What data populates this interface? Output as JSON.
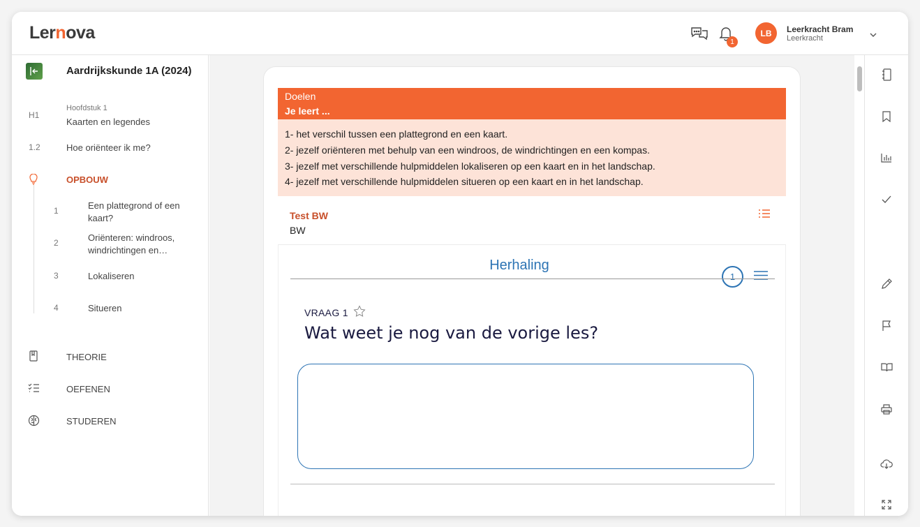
{
  "header": {
    "logo_left": "Ler",
    "logo_n": "n",
    "logo_right": "ova",
    "notification_count": "1",
    "user_initials": "LB",
    "user_name": "Leerkracht Bram",
    "user_role": "Leerkracht"
  },
  "sidebar": {
    "course_title": "Aardrijkskunde 1A (2024)",
    "chapter_code": "H1",
    "chapter_label": "Hoofdstuk 1",
    "chapter_title": "Kaarten en legendes",
    "section_code": "1.2",
    "section_title": "Hoe oriënteer ik me?",
    "opbouw_label": "OPBOUW",
    "opbouw_items": [
      {
        "num": "1",
        "line1": "Een plattegrond of een",
        "line2": "kaart?"
      },
      {
        "num": "2",
        "line1": "Oriënteren: windroos,",
        "line2": "windrichtingen en…"
      },
      {
        "num": "3",
        "line1": "Lokaliseren",
        "line2": ""
      },
      {
        "num": "4",
        "line1": "Situeren",
        "line2": ""
      }
    ],
    "theorie_label": "THEORIE",
    "oefenen_label": "OEFENEN",
    "studeren_label": "STUDEREN"
  },
  "doelen": {
    "title": "Doelen",
    "subtitle": "Je leert ...",
    "goals": [
      "1- het verschil tussen een plattegrond en een kaart.",
      "2- jezelf oriënteren met behulp van een windroos, de windrichtingen en een kompas.",
      "3- jezelf met verschillende hulpmiddelen lokaliseren op een kaart en in het landschap.",
      "4- jezelf met verschillende hulpmiddelen situeren op een kaart en in het landschap."
    ]
  },
  "test": {
    "title": "Test BW",
    "subtitle": "BW"
  },
  "exercise": {
    "section_title": "Herhaling",
    "question_count": "1",
    "question_label": "VRAAG 1",
    "question_text": "Wat weet je nog van de vorige les?",
    "answer_value": ""
  },
  "colors": {
    "accent": "#f26531",
    "accent_light": "#fde3d8",
    "link_blue": "#2d74b4",
    "opbouw_red": "#c8502b"
  }
}
